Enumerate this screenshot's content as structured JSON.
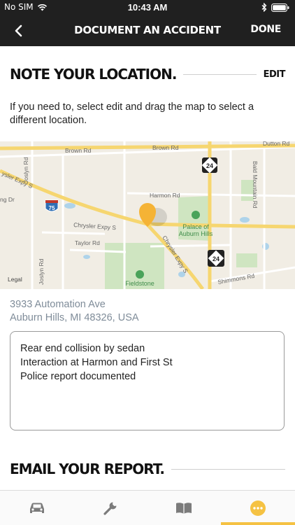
{
  "status": {
    "carrier": "No SIM",
    "time": "10:43 AM"
  },
  "nav": {
    "title": "DOCUMENT AN ACCIDENT",
    "done": "DONE"
  },
  "location_section": {
    "heading": "NOTE YOUR LOCATION.",
    "edit": "EDIT",
    "instruction": "If you need to, select edit and drag the map to select a different location."
  },
  "map": {
    "labels": {
      "brown_rd_1": "Brown Rd",
      "brown_rd_2": "Brown Rd",
      "dutton_rd": "Dutton Rd",
      "harmon_rd": "Harmon Rd",
      "chrysler_expy_1": "Chrysler Expy S",
      "chrysler_expy_2": "Chrysler Expy S",
      "chrysler_expy_3": "ysler Expy S",
      "taylor_rd": "Taylor Rd",
      "joslyn_rd_1": "Joslyn Rd",
      "joslyn_rd_2": "Joslyn Rd",
      "bald_mountain": "Bald Mountain Rd",
      "shimmons_rd": "Shimmons Rd",
      "palace_1": "Palace of",
      "palace_2": "Auburn Hills",
      "fieldstone": "Fieldstone",
      "legal": "Legal",
      "ng_dr": "ng Dr",
      "i75": "75",
      "m24_a": "24",
      "m24_b": "24"
    },
    "pin_color": "#f5b335"
  },
  "address": {
    "line1": "3933 Automation Ave",
    "line2": "Auburn Hills, MI 48326, USA"
  },
  "notes": {
    "lines": [
      "Rear end collision by sedan",
      "Interaction at Harmon and First St",
      "Police report documented"
    ]
  },
  "email_section": {
    "heading": "EMAIL YOUR REPORT."
  },
  "tabs": [
    {
      "icon": "car-icon"
    },
    {
      "icon": "wrench-icon"
    },
    {
      "icon": "book-icon"
    },
    {
      "icon": "more-icon",
      "active": true
    }
  ],
  "colors": {
    "header_bg": "#202020",
    "accent": "#f5c243",
    "address_text": "#7f8c99"
  }
}
